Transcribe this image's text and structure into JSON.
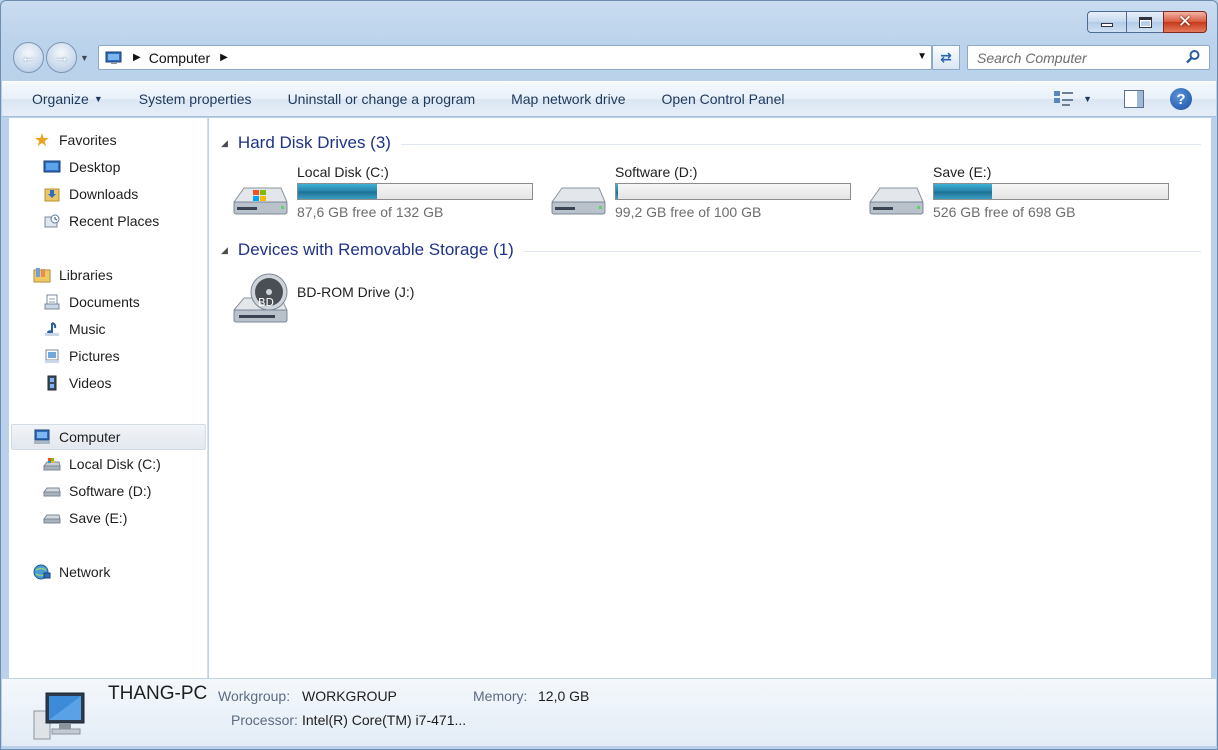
{
  "window": {
    "caption_buttons": {
      "minimize": "minimize-icon",
      "maximize": "maximize-icon",
      "close": "✕"
    }
  },
  "address": {
    "breadcrumb": [
      "Computer"
    ],
    "search_placeholder": "Search Computer"
  },
  "commands": {
    "organize": "Organize",
    "system_properties": "System properties",
    "uninstall": "Uninstall or change a program",
    "map_drive": "Map network drive",
    "control_panel": "Open Control Panel"
  },
  "nav": {
    "favorites": {
      "label": "Favorites",
      "items": [
        "Desktop",
        "Downloads",
        "Recent Places"
      ]
    },
    "libraries": {
      "label": "Libraries",
      "items": [
        "Documents",
        "Music",
        "Pictures",
        "Videos"
      ]
    },
    "computer": {
      "label": "Computer",
      "items": [
        "Local Disk (C:)",
        "Software (D:)",
        "Save (E:)"
      ]
    },
    "network": {
      "label": "Network"
    }
  },
  "groups": {
    "hdd": {
      "title": "Hard Disk Drives (3)",
      "drives": [
        {
          "name": "Local Disk (C:)",
          "free": "87,6 GB free of 132 GB",
          "used_fraction": 0.336
        },
        {
          "name": "Software (D:)",
          "free": "99,2 GB free of 100 GB",
          "used_fraction": 0.008
        },
        {
          "name": "Save (E:)",
          "free": "526 GB free of 698 GB",
          "used_fraction": 0.246
        }
      ]
    },
    "removable": {
      "title": "Devices with Removable Storage (1)",
      "drives": [
        {
          "name": "BD-ROM Drive (J:)",
          "badge": "BD"
        }
      ]
    }
  },
  "details": {
    "computer_name": "THANG-PC",
    "workgroup_label": "Workgroup:",
    "workgroup_value": "WORKGROUP",
    "memory_label": "Memory:",
    "memory_value": "12,0 GB",
    "processor_label": "Processor:",
    "processor_value": "Intel(R) Core(TM) i7-471..."
  },
  "colors": {
    "group_title": "#1e3287",
    "command_text": "#1e395b",
    "bar_fill": "#2581a8"
  }
}
